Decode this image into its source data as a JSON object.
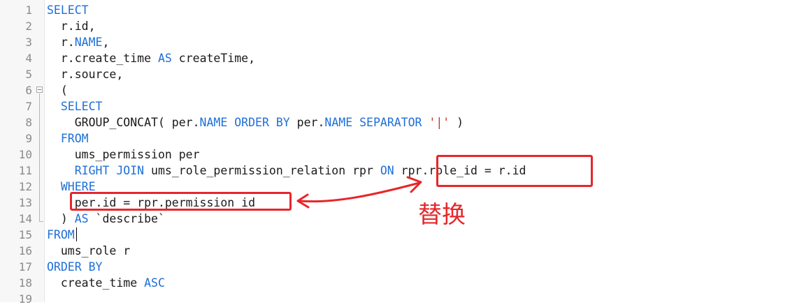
{
  "editor": {
    "lines": [
      {
        "n": "1",
        "tokens": [
          {
            "t": "SELECT",
            "c": "kw"
          }
        ]
      },
      {
        "n": "2",
        "tokens": [
          {
            "t": "  r.id,"
          }
        ]
      },
      {
        "n": "3",
        "tokens": [
          {
            "t": "  r."
          },
          {
            "t": "NAME",
            "c": "kw"
          },
          {
            "t": ","
          }
        ]
      },
      {
        "n": "4",
        "tokens": [
          {
            "t": "  r.create_time "
          },
          {
            "t": "AS",
            "c": "kw"
          },
          {
            "t": " createTime,"
          }
        ]
      },
      {
        "n": "5",
        "tokens": [
          {
            "t": "  r.source,"
          }
        ]
      },
      {
        "n": "6",
        "tokens": [
          {
            "t": "  ("
          }
        ]
      },
      {
        "n": "7",
        "tokens": [
          {
            "t": "  "
          },
          {
            "t": "SELECT",
            "c": "kw"
          }
        ]
      },
      {
        "n": "8",
        "tokens": [
          {
            "t": "    GROUP_CONCAT( per."
          },
          {
            "t": "NAME",
            "c": "kw"
          },
          {
            "t": " "
          },
          {
            "t": "ORDER BY",
            "c": "kw"
          },
          {
            "t": " per."
          },
          {
            "t": "NAME",
            "c": "kw"
          },
          {
            "t": " "
          },
          {
            "t": "SEPARATOR",
            "c": "kw"
          },
          {
            "t": " "
          },
          {
            "t": "'|'",
            "c": "str"
          },
          {
            "t": " )"
          }
        ]
      },
      {
        "n": "9",
        "tokens": [
          {
            "t": "  "
          },
          {
            "t": "FROM",
            "c": "kw"
          }
        ]
      },
      {
        "n": "10",
        "tokens": [
          {
            "t": "    ums_permission per"
          }
        ]
      },
      {
        "n": "11",
        "tokens": [
          {
            "t": "    "
          },
          {
            "t": "RIGHT JOIN",
            "c": "kw"
          },
          {
            "t": " ums_role_permission_relation rpr "
          },
          {
            "t": "ON",
            "c": "kw"
          },
          {
            "t": " rpr.role_id = r.id"
          }
        ]
      },
      {
        "n": "12",
        "tokens": [
          {
            "t": "  "
          },
          {
            "t": "WHERE",
            "c": "kw"
          }
        ]
      },
      {
        "n": "13",
        "tokens": [
          {
            "t": "    per.id = rpr.permission_id"
          }
        ]
      },
      {
        "n": "14",
        "tokens": [
          {
            "t": "  ) "
          },
          {
            "t": "AS",
            "c": "kw"
          },
          {
            "t": " `describe`"
          }
        ]
      },
      {
        "n": "15",
        "tokens": [
          {
            "t": "FROM",
            "c": "kw"
          }
        ]
      },
      {
        "n": "16",
        "tokens": [
          {
            "t": "  ums_role r"
          }
        ]
      },
      {
        "n": "17",
        "tokens": [
          {
            "t": "ORDER BY",
            "c": "kw"
          }
        ]
      },
      {
        "n": "18",
        "tokens": [
          {
            "t": "  create_time "
          },
          {
            "t": "ASC",
            "c": "kw"
          }
        ]
      },
      {
        "n": "19",
        "tokens": []
      }
    ]
  },
  "annotation": {
    "note": "替换",
    "color": "#e8262a"
  },
  "colors": {
    "keyword": "#1e6fd6",
    "string": "#c2362e",
    "text": "#1a1a1a"
  }
}
